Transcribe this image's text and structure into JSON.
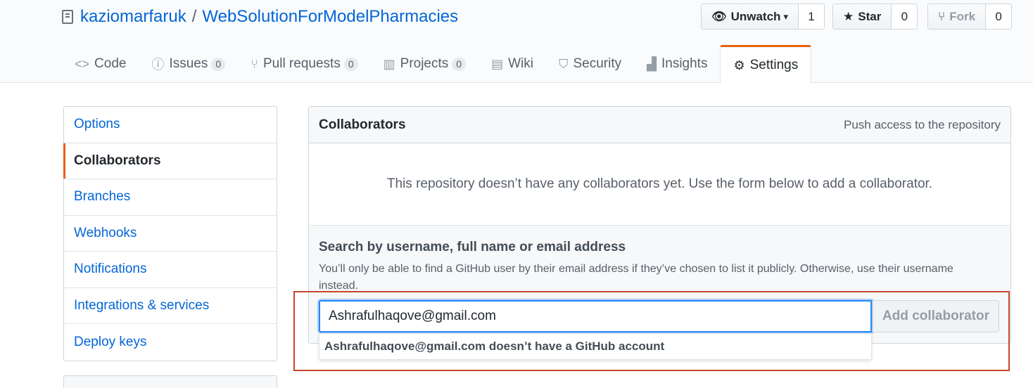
{
  "repo": {
    "owner": "kaziomarfaruk",
    "separator": "/",
    "name": "WebSolutionForModelPharmacies"
  },
  "actions": {
    "watch": {
      "label": "Unwatch",
      "caret": "▾",
      "count": "1"
    },
    "star": {
      "label": "Star",
      "count": "0"
    },
    "fork": {
      "label": "Fork",
      "count": "0"
    }
  },
  "tabs": [
    {
      "label": "Code",
      "icon": "code-icon",
      "glyph": "<>",
      "counter": ""
    },
    {
      "label": "Issues",
      "icon": "issue-icon",
      "glyph": "ⓘ",
      "counter": "0"
    },
    {
      "label": "Pull requests",
      "icon": "pull-request-icon",
      "glyph": "⑂",
      "counter": "0"
    },
    {
      "label": "Projects",
      "icon": "project-icon",
      "glyph": "▥",
      "counter": "0"
    },
    {
      "label": "Wiki",
      "icon": "book-icon",
      "glyph": "▤",
      "counter": ""
    },
    {
      "label": "Security",
      "icon": "shield-icon",
      "glyph": "⛉",
      "counter": ""
    },
    {
      "label": "Insights",
      "icon": "graph-icon",
      "glyph": "▟",
      "counter": ""
    },
    {
      "label": "Settings",
      "icon": "gear-icon",
      "glyph": "⚙",
      "counter": ""
    }
  ],
  "sidebar": {
    "items": [
      {
        "label": "Options"
      },
      {
        "label": "Collaborators"
      },
      {
        "label": "Branches"
      },
      {
        "label": "Webhooks"
      },
      {
        "label": "Notifications"
      },
      {
        "label": "Integrations & services"
      },
      {
        "label": "Deploy keys"
      }
    ]
  },
  "collaborators": {
    "title": "Collaborators",
    "note": "Push access to the repository",
    "blankslate": "This repository doesn’t have any collaborators yet. Use the form below to add a collaborator.",
    "search_label": "Search by username, full name or email address",
    "search_note": "You’ll only be able to find a GitHub user by their email address if they’ve chosen to list it publicly. Otherwise, use their username instead.",
    "input_value": "Ashrafulhaqove@gmail.com",
    "add_button": "Add collaborator",
    "autocomplete_message": "Ashrafulhaqove@gmail.com doesn’t have a GitHub account"
  },
  "colors": {
    "link": "#0366d6",
    "selected_accent": "#e36209",
    "highlight_border": "#c8452c"
  }
}
